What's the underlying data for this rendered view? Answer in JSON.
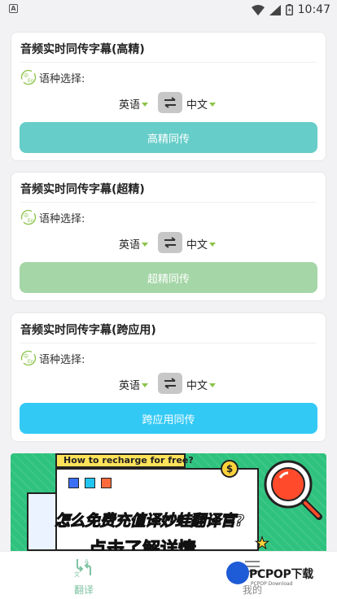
{
  "status_bar": {
    "time": "10:47",
    "notification_glyph": "A"
  },
  "cards": [
    {
      "title": "音频实时同传字幕(高精)",
      "lang_label": "语种选择:",
      "source_lang": "英语",
      "target_lang": "中文",
      "button_label": "高精同传",
      "button_color": "#66cdc9"
    },
    {
      "title": "音频实时同传字幕(超精)",
      "lang_label": "语种选择:",
      "source_lang": "英语",
      "target_lang": "中文",
      "button_label": "超精同传",
      "button_color": "#a5d6a7"
    },
    {
      "title": "音频实时同传字幕(跨应用)",
      "lang_label": "语种选择:",
      "source_lang": "英语",
      "target_lang": "中文",
      "button_label": "跨应用同传",
      "button_color": "#33c9f5"
    }
  ],
  "banner": {
    "question": "How to recharge for free?",
    "headline_pre": "怎么",
    "headline_highlight": "免费",
    "headline_post": "充值译妙蛙翻译官?",
    "subline": "点击了解详情",
    "coin_symbol": "$"
  },
  "tabs": [
    {
      "label": "翻译",
      "active": true
    },
    {
      "label": "我的",
      "active": false
    }
  ],
  "watermark": {
    "brand": "PCPOP下载",
    "tagline": "PCPOP Download"
  },
  "colors": {
    "accent_green": "#8bc34a",
    "tab_active": "#7fc3a2"
  }
}
